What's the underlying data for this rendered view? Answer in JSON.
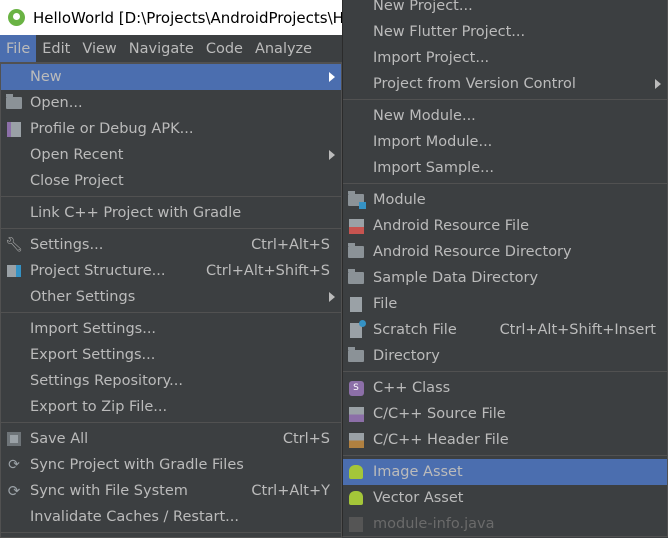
{
  "title": "HelloWorld [D:\\Projects\\AndroidProjects\\H",
  "menubar": [
    "File",
    "Edit",
    "View",
    "Navigate",
    "Code",
    "Analyze"
  ],
  "file_menu": [
    {
      "label": "New",
      "submenu": true,
      "highlighted": true
    },
    {
      "label": "Open...",
      "icon": "folder-open-icon"
    },
    {
      "label": "Profile or Debug APK...",
      "icon": "apk-icon"
    },
    {
      "label": "Open Recent",
      "submenu": true
    },
    {
      "label": "Close Project"
    },
    {
      "sep": true
    },
    {
      "label": "Link C++ Project with Gradle"
    },
    {
      "sep": true
    },
    {
      "label": "Settings...",
      "icon": "wrench-icon",
      "shortcut": "Ctrl+Alt+S"
    },
    {
      "label": "Project Structure...",
      "icon": "project-structure-icon",
      "shortcut": "Ctrl+Alt+Shift+S"
    },
    {
      "label": "Other Settings",
      "submenu": true
    },
    {
      "sep": true
    },
    {
      "label": "Import Settings..."
    },
    {
      "label": "Export Settings..."
    },
    {
      "label": "Settings Repository..."
    },
    {
      "label": "Export to Zip File..."
    },
    {
      "sep": true
    },
    {
      "label": "Save All",
      "icon": "save-icon",
      "shortcut": "Ctrl+S"
    },
    {
      "label": "Sync Project with Gradle Files",
      "icon": "gradle-sync-icon"
    },
    {
      "label": "Sync with File System",
      "icon": "sync-icon",
      "shortcut": "Ctrl+Alt+Y"
    },
    {
      "label": "Invalidate Caches / Restart..."
    },
    {
      "sep": true
    }
  ],
  "new_submenu": [
    {
      "label": "New Project..."
    },
    {
      "label": "New Flutter Project..."
    },
    {
      "label": "Import Project..."
    },
    {
      "label": "Project from Version Control",
      "submenu": true
    },
    {
      "sep": true
    },
    {
      "label": "New Module..."
    },
    {
      "label": "Import Module..."
    },
    {
      "label": "Import Sample..."
    },
    {
      "sep": true
    },
    {
      "label": "Module",
      "icon": "module-icon"
    },
    {
      "label": "Android Resource File",
      "icon": "resource-file-icon"
    },
    {
      "label": "Android Resource Directory",
      "icon": "folder-icon"
    },
    {
      "label": "Sample Data Directory",
      "icon": "folder-icon"
    },
    {
      "label": "File",
      "icon": "file-icon"
    },
    {
      "label": "Scratch File",
      "icon": "scratch-file-icon",
      "shortcut": "Ctrl+Alt+Shift+Insert"
    },
    {
      "label": "Directory",
      "icon": "folder-icon"
    },
    {
      "sep": true
    },
    {
      "label": "C++ Class",
      "icon": "cpp-class-icon"
    },
    {
      "label": "C/C++ Source File",
      "icon": "cpp-source-icon"
    },
    {
      "label": "C/C++ Header File",
      "icon": "cpp-header-icon"
    },
    {
      "sep": true
    },
    {
      "label": "Image Asset",
      "icon": "android-icon",
      "highlighted": true
    },
    {
      "label": "Vector Asset",
      "icon": "android-icon"
    },
    {
      "label": "module-info.java",
      "icon": "java-file-icon",
      "disabled": true
    }
  ],
  "colors": {
    "bg": "#3c3f41",
    "highlight": "#4b6eaf",
    "text": "#bbbbbb"
  }
}
